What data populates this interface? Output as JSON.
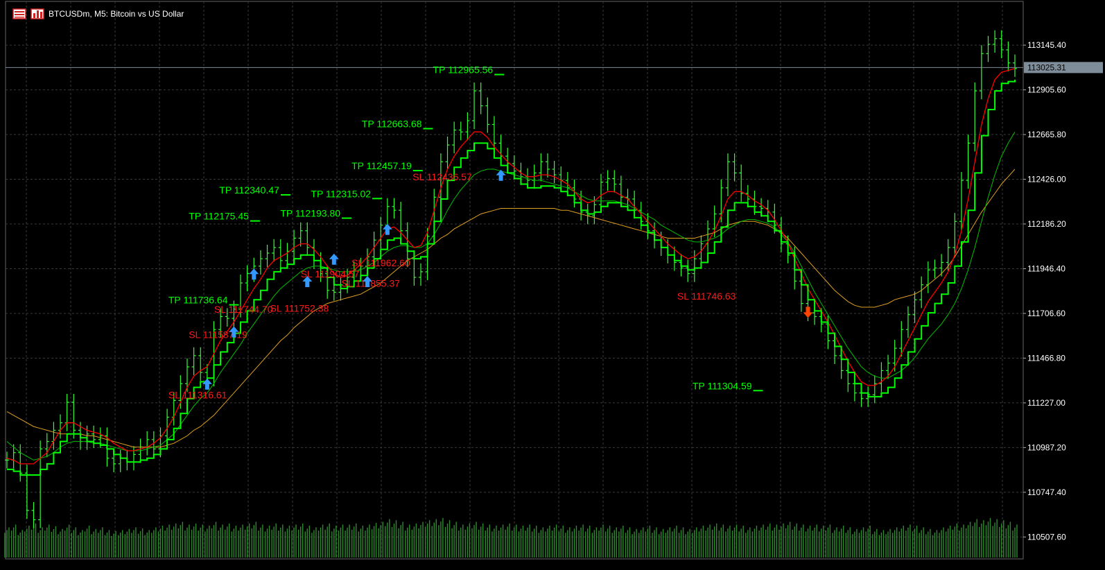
{
  "header": {
    "symbol": "BTCUSDm",
    "timeframe": "M5",
    "description": "Bitcoin vs US Dollar",
    "title_text": "BTCUSDm, M5:  Bitcoin vs US Dollar",
    "menu_icon": "table-icon",
    "chart_icon": "bar-chart-icon"
  },
  "colors": {
    "background": "#000000",
    "grid": "#3a3a3a",
    "bull_bar": "#33ff33",
    "volume": "#2e8b2e",
    "ma_fast_red": "#ff0000",
    "ma_mid_green": "#00c000",
    "ma_slow_orange": "#e0a020",
    "stop_line_green": "#00ff00",
    "tp_text": "#00ff00",
    "sl_text": "#ff1a1a",
    "buy_arrow": "#3399ff",
    "sell_arrow": "#ff4400",
    "current_price_bg": "#7f8d9a",
    "axis_text": "#ffffff"
  },
  "chart_data": {
    "type": "line",
    "symbol": "BTCUSDm",
    "timeframe": "M5",
    "ylim": [
      110390,
      113380
    ],
    "y_ticks": [
      "113145.40",
      "112905.60",
      "112665.80",
      "112426.00",
      "112186.20",
      "111946.40",
      "111706.60",
      "111466.80",
      "111227.00",
      "110987.20",
      "110747.40",
      "110507.60"
    ],
    "current_price": "113025.31",
    "price_series": [
      110920,
      110960,
      110850,
      110650,
      110600,
      110980,
      111020,
      111080,
      111120,
      111230,
      111080,
      111020,
      111060,
      111030,
      111050,
      110930,
      110900,
      110930,
      110910,
      110950,
      110990,
      111030,
      110980,
      111050,
      111150,
      111240,
      111330,
      111420,
      111480,
      111390,
      111360,
      111620,
      111690,
      111680,
      111730,
      111870,
      111920,
      111960,
      112000,
      112030,
      112060,
      111990,
      112040,
      112110,
      112150,
      112060,
      111990,
      111920,
      111830,
      111820,
      111860,
      111900,
      111940,
      111960,
      112010,
      112100,
      112180,
      112280,
      112260,
      112150,
      112000,
      111900,
      111930,
      112120,
      112330,
      112520,
      112610,
      112690,
      112680,
      112740,
      112900,
      112820,
      112720,
      112620,
      112550,
      112510,
      112470,
      112440,
      112420,
      112460,
      112520,
      112480,
      112450,
      112420,
      112380,
      112320,
      112250,
      112230,
      112290,
      112410,
      112430,
      112400,
      112330,
      112320,
      112260,
      112200,
      112150,
      112100,
      112060,
      112020,
      111980,
      111950,
      111920,
      112000,
      112080,
      112160,
      112240,
      112380,
      112520,
      112460,
      112350,
      112320,
      112280,
      112270,
      112250,
      112180,
      112080,
      112020,
      111880,
      111760,
      111710,
      111690,
      111650,
      111560,
      111480,
      111400,
      111330,
      111280,
      111250,
      111270,
      111330,
      111400,
      111440,
      111520,
      111620,
      111700,
      111780,
      111860,
      111940,
      111950,
      111980,
      112060,
      112200,
      112420,
      112620,
      112900,
      113100,
      113150,
      113180,
      113120,
      113050,
      113020
    ],
    "ma_fast": [
      110930,
      110920,
      110900,
      110900,
      110900,
      110930,
      110960,
      111020,
      111080,
      111120,
      111120,
      111100,
      111080,
      111070,
      111060,
      111040,
      111010,
      110990,
      110970,
      110970,
      110980,
      110990,
      111010,
      111040,
      111090,
      111150,
      111230,
      111310,
      111370,
      111400,
      111420,
      111490,
      111560,
      111610,
      111660,
      111720,
      111780,
      111840,
      111890,
      111950,
      111990,
      112010,
      112030,
      112060,
      112080,
      112080,
      112050,
      112010,
      111960,
      111920,
      111900,
      111910,
      111940,
      111970,
      112010,
      112060,
      112110,
      112160,
      112170,
      112140,
      112100,
      112060,
      112070,
      112140,
      112260,
      112380,
      112480,
      112550,
      112600,
      112640,
      112680,
      112680,
      112650,
      112600,
      112560,
      112520,
      112490,
      112460,
      112440,
      112440,
      112450,
      112450,
      112440,
      112420,
      112400,
      112360,
      112320,
      112300,
      112310,
      112340,
      112360,
      112360,
      112340,
      112320,
      112280,
      112240,
      112200,
      112160,
      112120,
      112080,
      112050,
      112020,
      112000,
      112010,
      112040,
      112090,
      112150,
      112230,
      112320,
      112360,
      112360,
      112340,
      112310,
      112290,
      112260,
      112210,
      112150,
      112090,
      112000,
      111920,
      111840,
      111780,
      111720,
      111660,
      111590,
      111520,
      111450,
      111390,
      111340,
      111320,
      111320,
      111340,
      111370,
      111420,
      111490,
      111560,
      111630,
      111700,
      111770,
      111820,
      111870,
      111930,
      112020,
      112150,
      112320,
      112520,
      112720,
      112860,
      112960,
      113000,
      113010,
      113020
    ],
    "ma_mid": [
      111020,
      110990,
      110960,
      110940,
      110920,
      110930,
      110940,
      110960,
      110990,
      111010,
      111020,
      111020,
      111020,
      111010,
      111010,
      111000,
      110990,
      110980,
      110970,
      110970,
      110970,
      110980,
      110990,
      111000,
      111030,
      111060,
      111110,
      111160,
      111210,
      111250,
      111280,
      111330,
      111390,
      111440,
      111490,
      111540,
      111600,
      111650,
      111700,
      111750,
      111800,
      111840,
      111870,
      111900,
      111930,
      111950,
      111960,
      111960,
      111950,
      111940,
      111930,
      111930,
      111930,
      111940,
      111960,
      111980,
      112010,
      112040,
      112060,
      112070,
      112070,
      112060,
      112060,
      112080,
      112130,
      112190,
      112260,
      112320,
      112370,
      112410,
      112450,
      112470,
      112480,
      112480,
      112470,
      112460,
      112450,
      112440,
      112430,
      112420,
      112420,
      112410,
      112400,
      112390,
      112380,
      112360,
      112340,
      112320,
      112310,
      112310,
      112310,
      112310,
      112300,
      112290,
      112270,
      112250,
      112230,
      112210,
      112180,
      112160,
      112140,
      112120,
      112100,
      112090,
      112090,
      112100,
      112110,
      112130,
      112160,
      112180,
      112200,
      112210,
      112210,
      112200,
      112190,
      112170,
      112130,
      112090,
      112030,
      111960,
      111890,
      111820,
      111760,
      111700,
      111640,
      111580,
      111520,
      111470,
      111420,
      111390,
      111370,
      111360,
      111360,
      111380,
      111400,
      111430,
      111470,
      111520,
      111570,
      111610,
      111650,
      111700,
      111760,
      111840,
      111940,
      112060,
      112200,
      112330,
      112450,
      112550,
      112620,
      112680
    ],
    "ma_slow": [
      111180,
      111160,
      111140,
      111120,
      111100,
      111090,
      111080,
      111070,
      111060,
      111060,
      111060,
      111060,
      111050,
      111050,
      111040,
      111030,
      111020,
      111010,
      111000,
      110990,
      110990,
      110990,
      110990,
      110990,
      111000,
      111010,
      111030,
      111050,
      111080,
      111100,
      111130,
      111160,
      111200,
      111240,
      111280,
      111320,
      111360,
      111400,
      111440,
      111480,
      111520,
      111560,
      111590,
      111630,
      111660,
      111690,
      111720,
      111740,
      111760,
      111770,
      111780,
      111790,
      111800,
      111810,
      111830,
      111850,
      111870,
      111900,
      111930,
      111960,
      111990,
      112010,
      112030,
      112050,
      112080,
      112110,
      112130,
      112160,
      112180,
      112200,
      112220,
      112240,
      112250,
      112260,
      112270,
      112270,
      112270,
      112270,
      112270,
      112270,
      112270,
      112270,
      112270,
      112260,
      112260,
      112250,
      112240,
      112230,
      112220,
      112210,
      112200,
      112190,
      112180,
      112170,
      112160,
      112150,
      112140,
      112130,
      112120,
      112110,
      112110,
      112110,
      112110,
      112110,
      112120,
      112130,
      112140,
      112160,
      112180,
      112190,
      112200,
      112200,
      112200,
      112190,
      112180,
      112160,
      112140,
      112110,
      112070,
      112030,
      111990,
      111950,
      111910,
      111870,
      111830,
      111800,
      111770,
      111750,
      111740,
      111740,
      111740,
      111750,
      111760,
      111780,
      111790,
      111800,
      111810,
      111830,
      111860,
      111890,
      111920,
      111960,
      112010,
      112070,
      112130,
      112190,
      112250,
      112300,
      112350,
      112400,
      112440,
      112480
    ],
    "volume": [
      0.55,
      0.6,
      0.5,
      0.58,
      0.62,
      0.55,
      0.6,
      0.57,
      0.52,
      0.6,
      0.55,
      0.5,
      0.58,
      0.52,
      0.55,
      0.5,
      0.48,
      0.5,
      0.52,
      0.55,
      0.53,
      0.5,
      0.55,
      0.58,
      0.6,
      0.62,
      0.65,
      0.6,
      0.62,
      0.6,
      0.58,
      0.65,
      0.6,
      0.62,
      0.58,
      0.6,
      0.62,
      0.65,
      0.6,
      0.58,
      0.62,
      0.6,
      0.58,
      0.6,
      0.62,
      0.58,
      0.55,
      0.6,
      0.62,
      0.58,
      0.6,
      0.6,
      0.62,
      0.58,
      0.6,
      0.63,
      0.65,
      0.7,
      0.68,
      0.65,
      0.6,
      0.62,
      0.65,
      0.68,
      0.7,
      0.72,
      0.68,
      0.65,
      0.6,
      0.62,
      0.65,
      0.62,
      0.6,
      0.58,
      0.6,
      0.62,
      0.6,
      0.58,
      0.6,
      0.58,
      0.55,
      0.58,
      0.6,
      0.58,
      0.55,
      0.58,
      0.6,
      0.58,
      0.55,
      0.6,
      0.58,
      0.55,
      0.58,
      0.55,
      0.52,
      0.55,
      0.58,
      0.55,
      0.52,
      0.55,
      0.58,
      0.55,
      0.52,
      0.55,
      0.58,
      0.6,
      0.62,
      0.6,
      0.58,
      0.6,
      0.58,
      0.55,
      0.58,
      0.6,
      0.62,
      0.6,
      0.62,
      0.65,
      0.62,
      0.6,
      0.58,
      0.6,
      0.58,
      0.6,
      0.55,
      0.58,
      0.55,
      0.52,
      0.55,
      0.58,
      0.52,
      0.5,
      0.52,
      0.55,
      0.58,
      0.6,
      0.58,
      0.55,
      0.52,
      0.5,
      0.55,
      0.58,
      0.62,
      0.6,
      0.65,
      0.7,
      0.68,
      0.72,
      0.7,
      0.68,
      0.65,
      0.6
    ],
    "tp_labels": [
      {
        "text": "TP 112965.56",
        "x": "0.42",
        "price": 112995
      },
      {
        "text": "TP 112663.68",
        "x": "0.35",
        "price": 112705
      },
      {
        "text": "TP 112457.19",
        "x": "0.34",
        "price": 112480
      },
      {
        "text": "TP 112340.47",
        "x": "0.21",
        "price": 112350
      },
      {
        "text": "TP 112315.02",
        "x": "0.30",
        "price": 112330
      },
      {
        "text": "TP 112175.45",
        "x": "0.18",
        "price": 112210
      },
      {
        "text": "TP 112193.80",
        "x": "0.27",
        "price": 112225
      },
      {
        "text": "TP 111736.64",
        "x": "0.16",
        "price": 111760
      },
      {
        "text": "TP 111304.59",
        "x": "0.675",
        "price": 111300
      }
    ],
    "sl_labels": [
      {
        "text": "SL 112436.57",
        "x": "0.40",
        "price": 112420
      },
      {
        "text": "SL 111962.60",
        "x": "0.34",
        "price": 111960
      },
      {
        "text": "SL 111904.57",
        "x": "0.29",
        "price": 111900
      },
      {
        "text": "SL 111855.37",
        "x": "0.33",
        "price": 111850
      },
      {
        "text": "SL 111744.70",
        "x": "0.205",
        "price": 111710
      },
      {
        "text": "SL 111752.38",
        "x": "0.26",
        "price": 111715
      },
      {
        "text": "SL 111587.19",
        "x": "0.18",
        "price": 111575
      },
      {
        "text": "SL 111316.61",
        "x": "0.16",
        "price": 111250
      },
      {
        "text": "SL 111746.63",
        "x": "0.66",
        "price": 111780
      }
    ],
    "buy_arrows": [
      {
        "i": 30,
        "price": 111320
      },
      {
        "i": 34,
        "price": 111600
      },
      {
        "i": 37,
        "price": 111910
      },
      {
        "i": 45,
        "price": 111870
      },
      {
        "i": 49,
        "price": 111990
      },
      {
        "i": 54,
        "price": 111870
      },
      {
        "i": 57,
        "price": 112150
      },
      {
        "i": 74,
        "price": 112440
      }
    ],
    "sell_arrows": [
      {
        "i": 120,
        "price": 111720
      }
    ]
  }
}
